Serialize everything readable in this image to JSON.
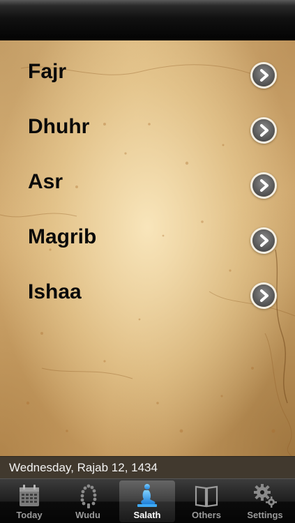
{
  "nav": {
    "title": ""
  },
  "prayers": [
    {
      "label": "Fajr"
    },
    {
      "label": "Dhuhr"
    },
    {
      "label": "Asr"
    },
    {
      "label": "Magrib"
    },
    {
      "label": "Ishaa"
    }
  ],
  "date_bar": {
    "text": "Wednesday, Rajab 12, 1434"
  },
  "tabs": [
    {
      "label": "Today",
      "icon": "calendar-icon",
      "selected": false
    },
    {
      "label": "Wudu",
      "icon": "prayer-beads-icon",
      "selected": false
    },
    {
      "label": "Salath",
      "icon": "praying-person-icon",
      "selected": true
    },
    {
      "label": "Others",
      "icon": "open-book-icon",
      "selected": false
    },
    {
      "label": "Settings",
      "icon": "gears-icon",
      "selected": false
    }
  ],
  "colors": {
    "tab_active_icon": "#3fa9f5",
    "tab_inactive": "#9a9a9a",
    "parchment": "#dcb981",
    "disclosure": "#5c5c5c"
  }
}
